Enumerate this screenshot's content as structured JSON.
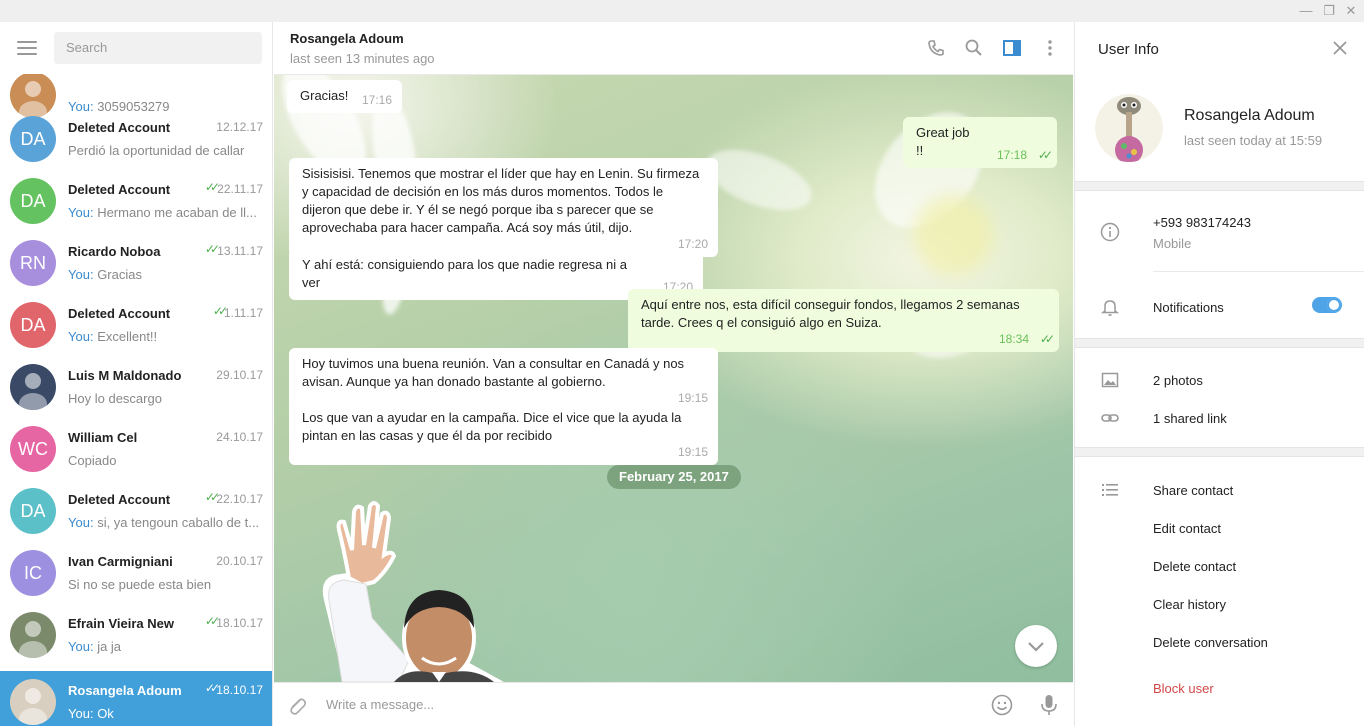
{
  "window": {
    "minimize": "—",
    "restore": "❐",
    "close": "✕"
  },
  "search": {
    "placeholder": "Search"
  },
  "chats": [
    {
      "initials": "",
      "name": "",
      "date": "",
      "preview_you": "You:",
      "preview": "3059053279",
      "color": "#c98d55",
      "checked": false,
      "photo": true
    },
    {
      "initials": "DA",
      "name": "Deleted Account",
      "date": "12.12.17",
      "preview_you": "",
      "preview": "Perdió la oportunidad de callar",
      "color": "#5aa3d9",
      "checked": false
    },
    {
      "initials": "DA",
      "name": "Deleted Account",
      "date": "22.11.17",
      "preview_you": "You:",
      "preview": "Hermano me acaban de ll...",
      "color": "#65c261",
      "checked": true
    },
    {
      "initials": "RN",
      "name": "Ricardo Noboa",
      "date": "13.11.17",
      "preview_you": "You:",
      "preview": "Gracias",
      "color": "#a88fde",
      "checked": true
    },
    {
      "initials": "DA",
      "name": "Deleted Account",
      "date": "1.11.17",
      "preview_you": "You:",
      "preview": "Excellent!!",
      "color": "#e0666c",
      "checked": true
    },
    {
      "initials": "",
      "name": "Luis M Maldonado",
      "date": "29.10.17",
      "preview_you": "",
      "preview": "Hoy lo descargo",
      "color": "#3a4a66",
      "checked": false,
      "photo": true
    },
    {
      "initials": "WC",
      "name": "William Cel",
      "date": "24.10.17",
      "preview_you": "",
      "preview": "Copiado",
      "color": "#e666a3",
      "checked": false
    },
    {
      "initials": "DA",
      "name": "Deleted Account",
      "date": "22.10.17",
      "preview_you": "You:",
      "preview": "si, ya tengoun caballo de t...",
      "color": "#5bc0c8",
      "checked": true
    },
    {
      "initials": "IC",
      "name": "Ivan Carmigniani",
      "date": "20.10.17",
      "preview_you": "",
      "preview": "Si no se puede esta bien",
      "color": "#9d90e0",
      "checked": false
    },
    {
      "initials": "",
      "name": "Efrain Vieira New",
      "date": "18.10.17",
      "preview_you": "You:",
      "preview": "ja ja",
      "color": "#7a8a6a",
      "checked": true,
      "photo": true
    },
    {
      "initials": "",
      "name": "Rosangela Adoum",
      "date": "18.10.17",
      "preview_you": "You:",
      "preview": "Ok",
      "color": "#d9cfc0",
      "checked": true,
      "photo": true,
      "active": true
    }
  ],
  "header": {
    "name": "Rosangela Adoum",
    "status": "last seen 13 minutes ago"
  },
  "messages": [
    {
      "dir": "in",
      "text": "Gracias!",
      "time": "17:16"
    },
    {
      "dir": "out",
      "text": "Great job !!",
      "time": "17:18"
    },
    {
      "dir": "in",
      "text": "Sisisisisi. Tenemos que mostrar el líder que hay en Lenin. Su firmeza y capacidad  de decisión en los más duros momentos. Todos le dijeron que debe ir. Y él se negó porque iba s parecer que se aprovechaba para hacer campaña. Acá soy más útil, dijo.",
      "time": "17:20"
    },
    {
      "dir": "in",
      "text": "Y ahí está: consiguiendo para los que nadie regresa ni a ver",
      "time": "17:20"
    },
    {
      "dir": "out",
      "text": "Aquí entre nos, esta difícil conseguir fondos, llegamos 2 semanas tarde. Crees q el consiguió algo en Suiza.",
      "time": "18:34"
    },
    {
      "dir": "in",
      "text": "Hoy tuvimos una buena reunión. Van a consultar en Canadá y nos avisan. Aunque ya han donado bastante al gobierno.",
      "time": "19:15"
    },
    {
      "dir": "in",
      "text": "Los que van a ayudar en la campaña. Dice el vice que la ayuda la pintan en las casas y que él da por recibido",
      "time": "19:15"
    }
  ],
  "date_divider": "February 25, 2017",
  "composer": {
    "placeholder": "Write a message..."
  },
  "info": {
    "title": "User Info",
    "name": "Rosangela Adoum",
    "seen": "last seen today at 15:59",
    "phone": "+593 983174243",
    "phone_type": "Mobile",
    "notifications": "Notifications",
    "notifications_on": true,
    "photos": "2 photos",
    "links": "1 shared link",
    "actions": [
      "Share contact",
      "Edit contact",
      "Delete contact",
      "Clear history",
      "Delete conversation"
    ],
    "block": "Block user"
  }
}
